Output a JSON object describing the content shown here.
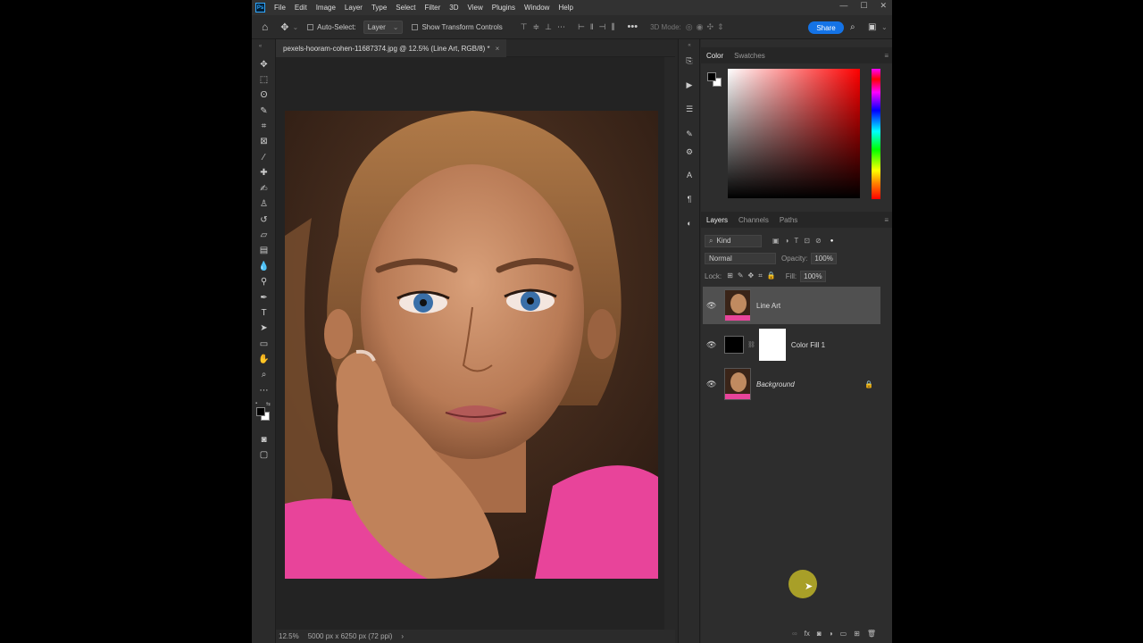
{
  "app": {
    "logo": "Ps"
  },
  "menu": [
    "File",
    "Edit",
    "Image",
    "Layer",
    "Type",
    "Select",
    "Filter",
    "3D",
    "View",
    "Plugins",
    "Window",
    "Help"
  ],
  "window_controls": [
    "—",
    "☐",
    "✕"
  ],
  "options": {
    "auto_select_label": "Auto-Select:",
    "auto_select_value": "Layer",
    "transform_label": "Show Transform Controls",
    "mode_3d": "3D Mode:",
    "share_label": "Share"
  },
  "document": {
    "tab_title": "pexels-hooram-cohen-11687374.jpg @ 12.5% (Line Art, RGB/8) *",
    "close": "×"
  },
  "status": {
    "zoom": "12.5%",
    "info": "5000 px x 6250 px (72 ppi)",
    "arrow": "›"
  },
  "color_panel": {
    "tabs": [
      "Color",
      "Swatches"
    ],
    "foreground": "#000000",
    "background": "#ffffff"
  },
  "layers_panel": {
    "tabs": [
      "Layers",
      "Channels",
      "Paths"
    ],
    "kind_label": "Kind",
    "blend_mode": "Normal",
    "opacity_label": "Opacity:",
    "opacity_value": "100%",
    "lock_label": "Lock:",
    "fill_label": "Fill:",
    "fill_value": "100%",
    "layers": [
      {
        "name": "Line Art",
        "selected": true
      },
      {
        "name": "Color Fill 1",
        "selected": false
      },
      {
        "name": "Background",
        "selected": false,
        "locked": true
      }
    ]
  },
  "colors": {
    "accent": "#1473e6",
    "jacket": "#e8449a"
  }
}
